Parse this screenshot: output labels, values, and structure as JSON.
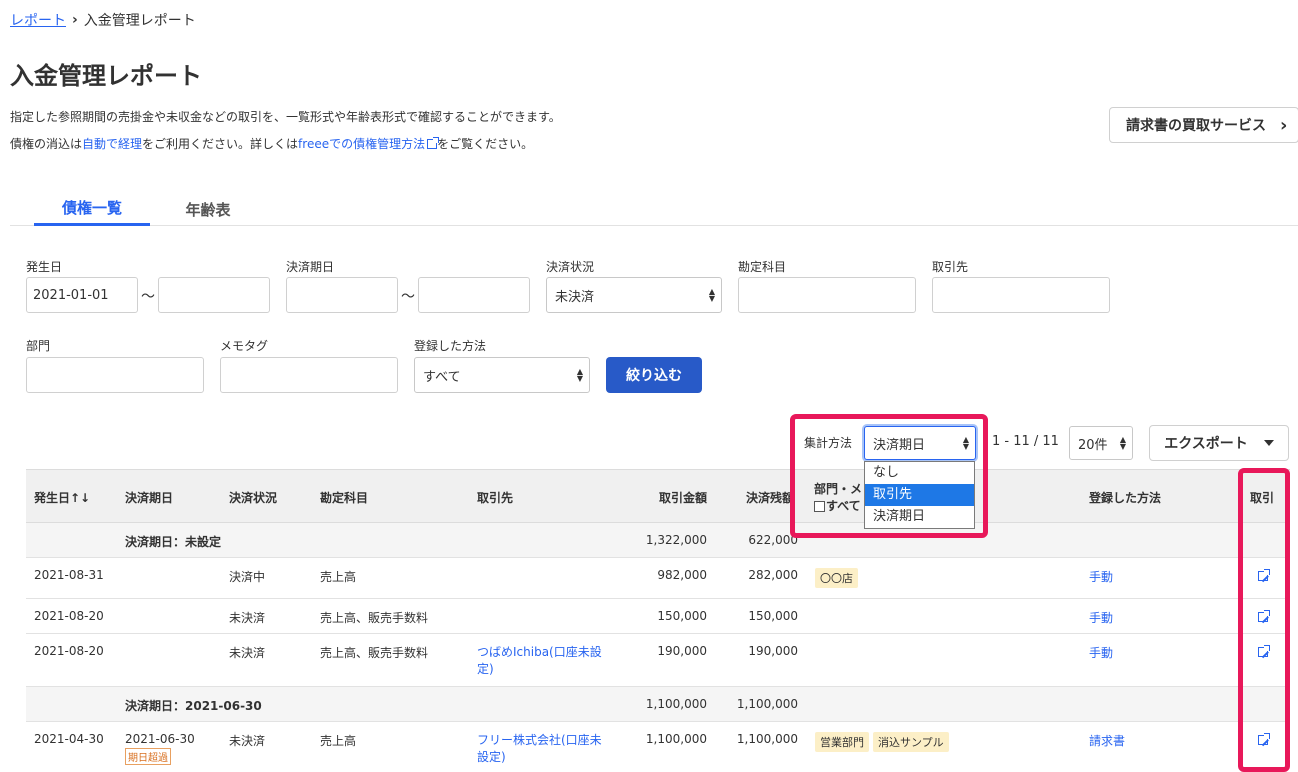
{
  "breadcrumb": {
    "parent": "レポート",
    "current": "入金管理レポート"
  },
  "page": {
    "title": "入金管理レポート",
    "desc1": "指定した参照期間の売掛金や未収金などの取引を、一覧形式や年齢表形式で確認することができます。",
    "desc2_pre": "債権の消込は",
    "desc2_link1": "自動で経理",
    "desc2_mid": "をご利用ください。詳しくは",
    "desc2_link2": "freeeでの債権管理方法",
    "desc2_post": "をご覧ください。",
    "service_btn": "請求書の買取サービス"
  },
  "tabs": [
    {
      "label": "債権一覧"
    },
    {
      "label": "年齢表"
    }
  ],
  "filters": {
    "issue_date_label": "発生日",
    "issue_date_from": "2021-01-01",
    "issue_date_to": "",
    "tilde": "〜",
    "due_date_label": "決済期日",
    "status_label": "決済状況",
    "status_value": "未決済",
    "account_label": "勘定科目",
    "partner_label": "取引先",
    "dept_label": "部門",
    "memo_label": "メモタグ",
    "method_label": "登録した方法",
    "method_value": "すべて",
    "submit": "絞り込む"
  },
  "toolbar": {
    "agg_label": "集計方法",
    "agg_value": "決済期日",
    "agg_options": [
      "なし",
      "取引先",
      "決済期日"
    ],
    "pager": "1 - 11 / 11",
    "per_page": "20件",
    "export": "エクスポート"
  },
  "table": {
    "headers": {
      "issue_date": "発生日↑↓",
      "due_date": "決済期日",
      "status": "決済状況",
      "account": "勘定科目",
      "partner": "取引先",
      "amount": "取引金額",
      "balance": "決済残額",
      "dept_memo": "部門・メ",
      "all": "すべて",
      "method": "登録した方法",
      "deal": "取引"
    },
    "groups": [
      {
        "label": "決済期日：未設定",
        "amount": "1,322,000",
        "balance": "622,000",
        "rows": [
          {
            "issue_date": "2021-08-31",
            "due_date": "",
            "status": "決済中",
            "account": "売上高",
            "partner": "",
            "amount": "982,000",
            "balance": "282,000",
            "tags": [
              "〇〇店"
            ],
            "method": "手動",
            "overdue": ""
          },
          {
            "issue_date": "2021-08-20",
            "due_date": "",
            "status": "未決済",
            "account": "売上高、販売手数料",
            "partner": "",
            "amount": "150,000",
            "balance": "150,000",
            "tags": [],
            "method": "手動",
            "overdue": ""
          },
          {
            "issue_date": "2021-08-20",
            "due_date": "",
            "status": "未決済",
            "account": "売上高、販売手数料",
            "partner_l1": "つばめIchiba(口座未設",
            "partner_l2": "定)",
            "amount": "190,000",
            "balance": "190,000",
            "tags": [],
            "method": "手動",
            "overdue": ""
          }
        ]
      },
      {
        "label": "決済期日：2021-06-30",
        "amount": "1,100,000",
        "balance": "1,100,000",
        "rows": [
          {
            "issue_date": "2021-04-30",
            "due_date": "2021-06-30",
            "status": "未決済",
            "account": "売上高",
            "partner_l1": "フリー株式会社(口座未",
            "partner_l2": "設定)",
            "amount": "1,100,000",
            "balance": "1,100,000",
            "tags": [
              "営業部門",
              "消込サンプル"
            ],
            "method": "請求書",
            "overdue": "期日超過"
          }
        ]
      }
    ]
  },
  "colors": {
    "accent": "#2864f0",
    "primary_button": "#285ac8",
    "highlight": "#e8185a",
    "tag_bg": "#fcefc7"
  }
}
